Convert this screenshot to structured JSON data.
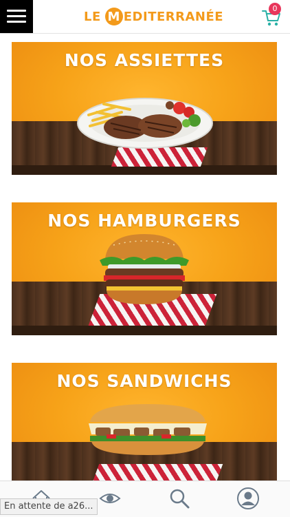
{
  "header": {
    "logo_prefix": "LE",
    "logo_m": "M",
    "logo_suffix": "EDITERRANÉE",
    "cart_count": "0",
    "accent_color": "#f39a1b"
  },
  "categories": [
    {
      "title": "NOS ASSIETTES",
      "image": "plate-with-burgers-and-fries"
    },
    {
      "title": "NOS HAMBURGERS",
      "image": "hamburger"
    },
    {
      "title": "NOS SANDWICHS",
      "image": "kebab-sandwich"
    }
  ],
  "bottom_nav": {
    "items": [
      "home-icon",
      "eye-icon",
      "search-icon",
      "account-icon"
    ]
  },
  "status_text": "En attente de a26..."
}
